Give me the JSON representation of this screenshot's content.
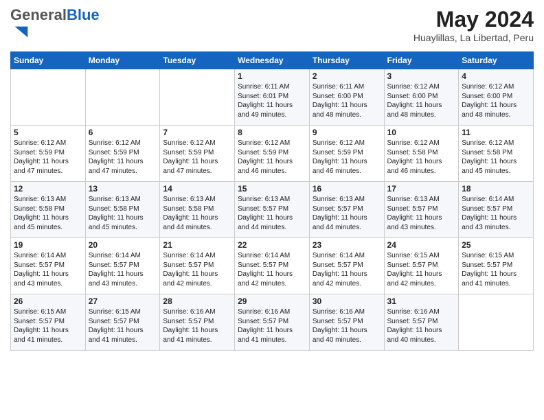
{
  "header": {
    "logo_general": "General",
    "logo_blue": "Blue",
    "month_year": "May 2024",
    "location": "Huaylillas, La Libertad, Peru"
  },
  "days_of_week": [
    "Sunday",
    "Monday",
    "Tuesday",
    "Wednesday",
    "Thursday",
    "Friday",
    "Saturday"
  ],
  "weeks": [
    [
      {
        "day": "",
        "info": ""
      },
      {
        "day": "",
        "info": ""
      },
      {
        "day": "",
        "info": ""
      },
      {
        "day": "1",
        "info": "Sunrise: 6:11 AM\nSunset: 6:01 PM\nDaylight: 11 hours\nand 49 minutes."
      },
      {
        "day": "2",
        "info": "Sunrise: 6:11 AM\nSunset: 6:00 PM\nDaylight: 11 hours\nand 48 minutes."
      },
      {
        "day": "3",
        "info": "Sunrise: 6:12 AM\nSunset: 6:00 PM\nDaylight: 11 hours\nand 48 minutes."
      },
      {
        "day": "4",
        "info": "Sunrise: 6:12 AM\nSunset: 6:00 PM\nDaylight: 11 hours\nand 48 minutes."
      }
    ],
    [
      {
        "day": "5",
        "info": "Sunrise: 6:12 AM\nSunset: 5:59 PM\nDaylight: 11 hours\nand 47 minutes."
      },
      {
        "day": "6",
        "info": "Sunrise: 6:12 AM\nSunset: 5:59 PM\nDaylight: 11 hours\nand 47 minutes."
      },
      {
        "day": "7",
        "info": "Sunrise: 6:12 AM\nSunset: 5:59 PM\nDaylight: 11 hours\nand 47 minutes."
      },
      {
        "day": "8",
        "info": "Sunrise: 6:12 AM\nSunset: 5:59 PM\nDaylight: 11 hours\nand 46 minutes."
      },
      {
        "day": "9",
        "info": "Sunrise: 6:12 AM\nSunset: 5:59 PM\nDaylight: 11 hours\nand 46 minutes."
      },
      {
        "day": "10",
        "info": "Sunrise: 6:12 AM\nSunset: 5:58 PM\nDaylight: 11 hours\nand 46 minutes."
      },
      {
        "day": "11",
        "info": "Sunrise: 6:12 AM\nSunset: 5:58 PM\nDaylight: 11 hours\nand 45 minutes."
      }
    ],
    [
      {
        "day": "12",
        "info": "Sunrise: 6:13 AM\nSunset: 5:58 PM\nDaylight: 11 hours\nand 45 minutes."
      },
      {
        "day": "13",
        "info": "Sunrise: 6:13 AM\nSunset: 5:58 PM\nDaylight: 11 hours\nand 45 minutes."
      },
      {
        "day": "14",
        "info": "Sunrise: 6:13 AM\nSunset: 5:58 PM\nDaylight: 11 hours\nand 44 minutes."
      },
      {
        "day": "15",
        "info": "Sunrise: 6:13 AM\nSunset: 5:57 PM\nDaylight: 11 hours\nand 44 minutes."
      },
      {
        "day": "16",
        "info": "Sunrise: 6:13 AM\nSunset: 5:57 PM\nDaylight: 11 hours\nand 44 minutes."
      },
      {
        "day": "17",
        "info": "Sunrise: 6:13 AM\nSunset: 5:57 PM\nDaylight: 11 hours\nand 43 minutes."
      },
      {
        "day": "18",
        "info": "Sunrise: 6:14 AM\nSunset: 5:57 PM\nDaylight: 11 hours\nand 43 minutes."
      }
    ],
    [
      {
        "day": "19",
        "info": "Sunrise: 6:14 AM\nSunset: 5:57 PM\nDaylight: 11 hours\nand 43 minutes."
      },
      {
        "day": "20",
        "info": "Sunrise: 6:14 AM\nSunset: 5:57 PM\nDaylight: 11 hours\nand 43 minutes."
      },
      {
        "day": "21",
        "info": "Sunrise: 6:14 AM\nSunset: 5:57 PM\nDaylight: 11 hours\nand 42 minutes."
      },
      {
        "day": "22",
        "info": "Sunrise: 6:14 AM\nSunset: 5:57 PM\nDaylight: 11 hours\nand 42 minutes."
      },
      {
        "day": "23",
        "info": "Sunrise: 6:14 AM\nSunset: 5:57 PM\nDaylight: 11 hours\nand 42 minutes."
      },
      {
        "day": "24",
        "info": "Sunrise: 6:15 AM\nSunset: 5:57 PM\nDaylight: 11 hours\nand 42 minutes."
      },
      {
        "day": "25",
        "info": "Sunrise: 6:15 AM\nSunset: 5:57 PM\nDaylight: 11 hours\nand 41 minutes."
      }
    ],
    [
      {
        "day": "26",
        "info": "Sunrise: 6:15 AM\nSunset: 5:57 PM\nDaylight: 11 hours\nand 41 minutes."
      },
      {
        "day": "27",
        "info": "Sunrise: 6:15 AM\nSunset: 5:57 PM\nDaylight: 11 hours\nand 41 minutes."
      },
      {
        "day": "28",
        "info": "Sunrise: 6:16 AM\nSunset: 5:57 PM\nDaylight: 11 hours\nand 41 minutes."
      },
      {
        "day": "29",
        "info": "Sunrise: 6:16 AM\nSunset: 5:57 PM\nDaylight: 11 hours\nand 41 minutes."
      },
      {
        "day": "30",
        "info": "Sunrise: 6:16 AM\nSunset: 5:57 PM\nDaylight: 11 hours\nand 40 minutes."
      },
      {
        "day": "31",
        "info": "Sunrise: 6:16 AM\nSunset: 5:57 PM\nDaylight: 11 hours\nand 40 minutes."
      },
      {
        "day": "",
        "info": ""
      }
    ]
  ]
}
